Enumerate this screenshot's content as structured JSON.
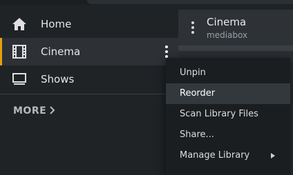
{
  "sidebar": {
    "items": [
      {
        "label": "Home",
        "icon": "home-icon"
      },
      {
        "label": "Cinema",
        "icon": "film-icon",
        "active": true
      },
      {
        "label": "Shows",
        "icon": "monitor-icon"
      }
    ],
    "more_label": "MORE"
  },
  "content": {
    "title": "Cinema",
    "subtitle": "mediabox"
  },
  "context_menu": {
    "items": [
      {
        "label": "Unpin"
      },
      {
        "label": "Reorder",
        "highlighted": true
      },
      {
        "label": "Scan Library Files"
      },
      {
        "label": "Share..."
      },
      {
        "label": "Manage Library",
        "has_submenu": true
      }
    ]
  },
  "colors": {
    "accent": "#e5a00d",
    "background": "#1f2326",
    "menu_background": "#1b1e21"
  }
}
